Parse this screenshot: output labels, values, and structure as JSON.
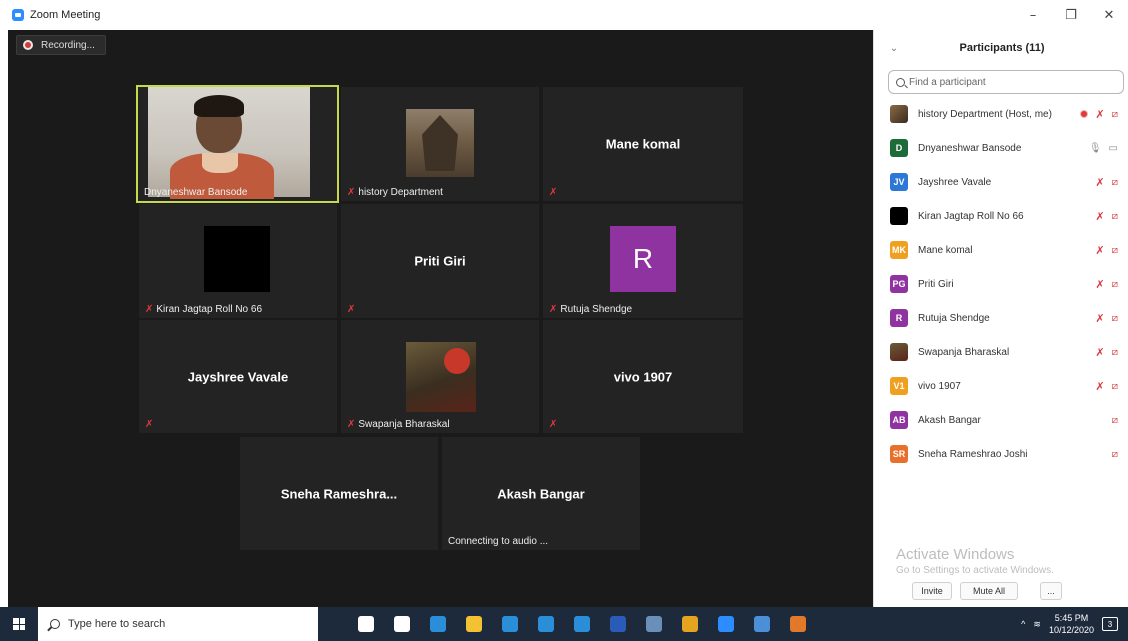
{
  "window": {
    "title": "Zoom Meeting",
    "controls": {
      "minimize": "–",
      "maximize": "❐",
      "close": "✕"
    }
  },
  "meeting": {
    "recording_label": "Recording...",
    "tiles": [
      {
        "name": "Dnyaneshwar Bansode",
        "type": "video",
        "active": true,
        "muted": false
      },
      {
        "name": "history Department",
        "type": "picture-temple",
        "muted": true
      },
      {
        "name": "",
        "big_name": "Mane komal",
        "type": "name",
        "muted": true
      },
      {
        "name": "Kiran Jagtap Roll No 66",
        "type": "black",
        "muted": true
      },
      {
        "name": "",
        "big_name": "Priti Giri",
        "type": "name",
        "muted": true
      },
      {
        "name": "Rutuja Shendge",
        "type": "letter",
        "letter": "R",
        "muted": true
      },
      {
        "name": "",
        "big_name": "Jayshree Vavale",
        "type": "name",
        "muted": true
      },
      {
        "name": "Swapanja Bharaskal",
        "type": "poster",
        "muted": true
      },
      {
        "name": "",
        "big_name": "vivo 1907",
        "type": "name",
        "muted": true
      },
      {
        "name": "",
        "big_name": "Sneha  Rameshra...",
        "type": "name",
        "muted": false
      },
      {
        "name": "Connecting to audio ...",
        "big_name": "Akash Bangar",
        "type": "name",
        "muted": false
      }
    ]
  },
  "participants": {
    "title": "Participants (11)",
    "search_placeholder": "Find a participant",
    "list": [
      {
        "name": "history Department (Host, me)",
        "avatar": "",
        "avatar_style": "img-a",
        "color": "",
        "recording": true,
        "muted": true,
        "video_off": true
      },
      {
        "name": "Dnyaneshwar Bansode",
        "avatar": "D",
        "color": "#1e6b3a",
        "mic_on": true,
        "video_on": true
      },
      {
        "name": "Jayshree Vavale",
        "avatar": "JV",
        "color": "#2d78d6",
        "muted": true,
        "video_off": true
      },
      {
        "name": "Kiran Jagtap Roll No 66",
        "avatar": "",
        "avatar_style": "img-b",
        "color": "",
        "muted": true,
        "video_off": true
      },
      {
        "name": "Mane komal",
        "avatar": "MK",
        "color": "#f0a020",
        "muted": true,
        "video_off": true
      },
      {
        "name": "Priti Giri",
        "avatar": "PG",
        "color": "#8f33a0",
        "muted": true,
        "video_off": true
      },
      {
        "name": "Rutuja Shendge",
        "avatar": "R",
        "color": "#8f33a0",
        "muted": true,
        "video_off": true
      },
      {
        "name": "Swapanja Bharaskal",
        "avatar": "",
        "avatar_style": "img-c",
        "color": "",
        "muted": true,
        "video_off": true
      },
      {
        "name": "vivo 1907",
        "avatar": "V1",
        "color": "#f0a020",
        "muted": true,
        "video_off": true
      },
      {
        "name": "Akash Bangar",
        "avatar": "AB",
        "color": "#8f33a0",
        "video_off": true
      },
      {
        "name": "Sneha Rameshrao Joshi",
        "avatar": "SR",
        "color": "#e8702a",
        "video_off": true
      }
    ],
    "footer": {
      "invite": "Invite",
      "mute_all": "Mute All",
      "more": "..."
    }
  },
  "watermark": {
    "line1": "Activate Windows",
    "line2": "Go to Settings to activate Windows."
  },
  "taskbar": {
    "search_placeholder": "Type here to search",
    "apps": [
      {
        "icon": "cortana-icon",
        "color": "#ffffff"
      },
      {
        "icon": "task-view-icon",
        "color": "#ffffff"
      },
      {
        "icon": "edge-icon",
        "color": "#2a8fd8"
      },
      {
        "icon": "file-explorer-icon",
        "color": "#f2c233"
      },
      {
        "icon": "store-icon",
        "color": "#2a8fd8"
      },
      {
        "icon": "mail-icon",
        "color": "#2a8fd8"
      },
      {
        "icon": "app-icon",
        "color": "#2a8fd8"
      },
      {
        "icon": "word-icon",
        "color": "#2b5bb8"
      },
      {
        "icon": "camera-icon",
        "color": "#6a8fb8"
      },
      {
        "icon": "chrome-icon",
        "color": "#e4a321"
      },
      {
        "icon": "zoom-icon",
        "color": "#2d8cff"
      },
      {
        "icon": "photos-icon",
        "color": "#4a8fd8"
      },
      {
        "icon": "paint-icon",
        "color": "#e07a2a"
      }
    ],
    "tray": {
      "time": "5:45 PM",
      "date": "10/12/2020",
      "notifications": "3"
    }
  }
}
